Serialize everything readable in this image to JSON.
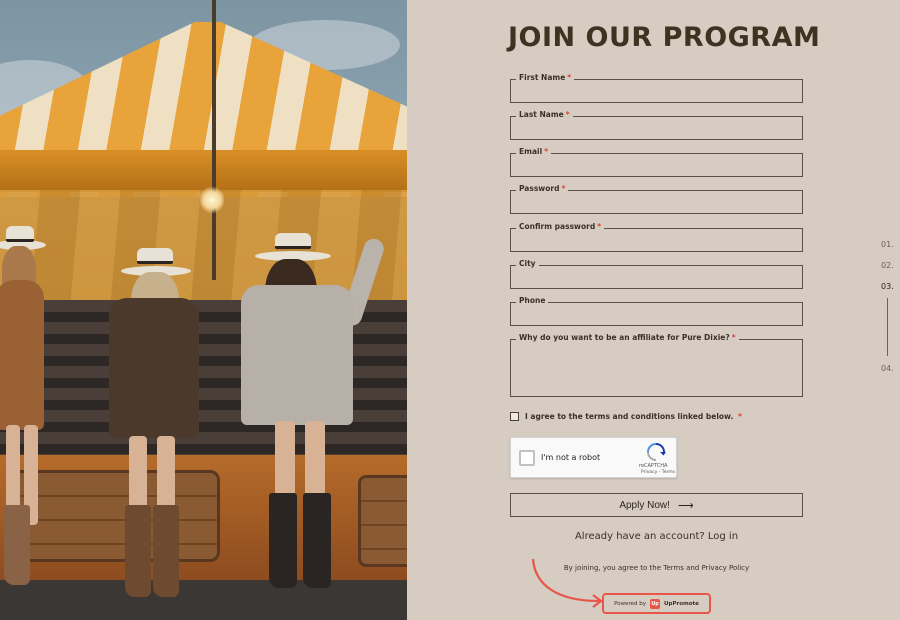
{
  "title": "JOIN OUR PROGRAM",
  "fields": [
    {
      "label": "First Name",
      "required": true,
      "value": ""
    },
    {
      "label": "Last Name",
      "required": true,
      "value": ""
    },
    {
      "label": "Email",
      "required": true,
      "value": ""
    },
    {
      "label": "Password",
      "required": true,
      "value": ""
    },
    {
      "label": "Confirm password",
      "required": true,
      "value": ""
    },
    {
      "label": "City",
      "required": false,
      "value": ""
    },
    {
      "label": "Phone",
      "required": false,
      "value": ""
    }
  ],
  "why": {
    "label": "Why do you want to be an affiliate for Pure Dixie?",
    "required": true,
    "value": ""
  },
  "required_marker": "*",
  "terms": {
    "label": "I agree to the terms and conditions linked below.",
    "required": true,
    "checked": false
  },
  "captcha": {
    "label": "I'm not a robot",
    "brand": "reCAPTCHA",
    "links": "Privacy - Terms"
  },
  "apply": {
    "label": "Apply Now!",
    "arrow": "⟶"
  },
  "login": {
    "prompt": "Already have an account?",
    "link": "Log in"
  },
  "joining_text": "By joining, you agree to the Terms and Privacy Policy",
  "powered": {
    "prefix": "Powered by",
    "brand": "UpPromote",
    "logo": "Up"
  },
  "steps": [
    {
      "label": "01.",
      "active": false
    },
    {
      "label": "02.",
      "active": false
    },
    {
      "label": "03.",
      "active": true
    },
    {
      "label": "04.",
      "active": false
    }
  ],
  "colors": {
    "background": "#d6ccc2",
    "title": "#3e3220",
    "required": "#d6453a",
    "highlight": "#e8564a"
  },
  "icons": {
    "apply_arrow": "arrow-right-icon",
    "captcha_logo": "recaptcha-logo-icon",
    "annotation": "curved-arrow-icon"
  }
}
